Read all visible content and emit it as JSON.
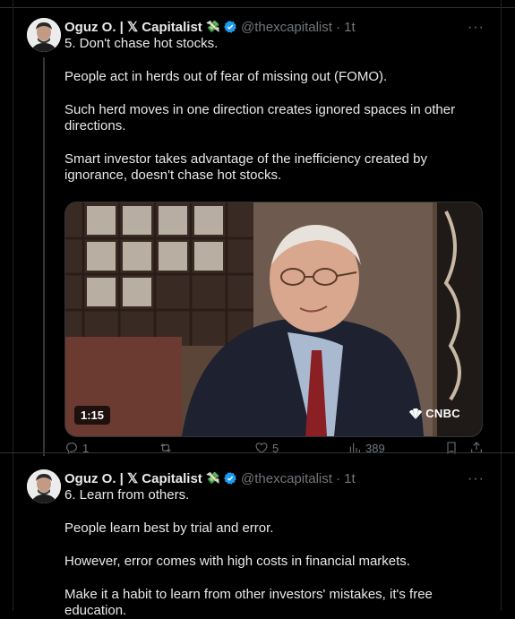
{
  "tweets": [
    {
      "author_name": "Oguz O. | 𝕏 Capitalist",
      "emoji": "💸",
      "handle": "@thexcapitalist",
      "time": "· 1t",
      "more": "···",
      "paragraphs": [
        "5. Don't chase hot stocks.",
        "People act in herds out of fear of missing out (FOMO).",
        "Such herd moves in one direction creates ignored spaces in other directions.",
        "Smart investor takes advantage of the inefficiency created by ignorance, doesn't chase hot stocks."
      ],
      "video": {
        "duration": "1:15",
        "watermark": "CNBC"
      },
      "actions": {
        "replies": "1",
        "reposts": "",
        "likes": "5",
        "views": "389"
      }
    },
    {
      "author_name": "Oguz O. | 𝕏 Capitalist",
      "emoji": "💸",
      "handle": "@thexcapitalist",
      "time": "· 1t",
      "more": "···",
      "paragraphs": [
        "6. Learn from others.",
        "People learn best by trial and error.",
        "However, error comes with high costs in financial markets.",
        "Make it a habit to learn from other investors' mistakes, it's free education."
      ]
    }
  ],
  "colors": {
    "background": "#000000",
    "text": "#e7e9ea",
    "muted": "#71767b",
    "verified": "#1d9bf0",
    "border": "#2f3336"
  }
}
